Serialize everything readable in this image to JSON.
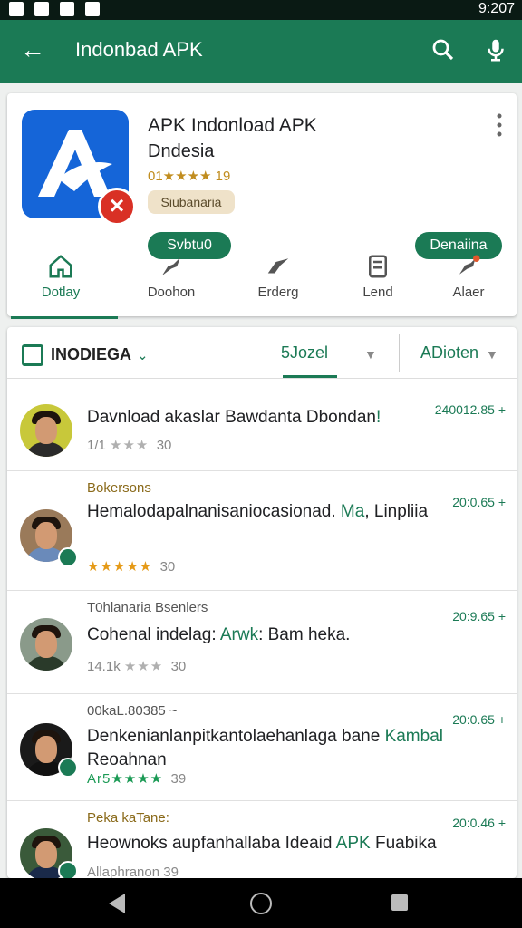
{
  "status_bar": {
    "time": "9:207"
  },
  "app_bar": {
    "title": "Indonbad APK",
    "back_icon": "arrow-back-icon",
    "search_icon": "search-icon",
    "mic_icon": "mic-icon"
  },
  "app_card": {
    "name": "APK Indonload APK",
    "developer": "Dndesia",
    "rating_text": "01★★★★ 19",
    "chip": "Siubanaria",
    "button_left": "Svbtu0",
    "button_right": "Denaiina",
    "tabs": [
      {
        "label": "Dotlay",
        "icon": "home-icon",
        "active": true
      },
      {
        "label": "Doohon",
        "icon": "share-icon",
        "active": false
      },
      {
        "label": "Erderg",
        "icon": "send-icon",
        "active": false
      },
      {
        "label": "Lend",
        "icon": "document-icon",
        "active": false
      },
      {
        "label": "Alaer",
        "icon": "notify-icon",
        "active": false
      }
    ]
  },
  "filter_bar": {
    "label": "INODIEGA",
    "sort": "5Jozel",
    "action": "ADioten"
  },
  "reviews": [
    {
      "subtitle": "",
      "title": "Davnload akaslar Bawdanta Dbondan",
      "title_accent": "!",
      "meta_prefix": "1/1",
      "stars": "★★★",
      "count": "30",
      "date": "240012.85 +"
    },
    {
      "subtitle": "Bokersons",
      "title": "Hemalodapalnanisaniocasionad.",
      "title_accent": "Ma",
      "title_tail": ", Linpliia",
      "meta_prefix": "",
      "stars": "★★★★★",
      "count": "30",
      "date": "20:0.65 +"
    },
    {
      "subtitle": "T0hlanaria Bsenlers",
      "title": "Cohenal indelag: ",
      "title_accent": "Arwk",
      "title_tail": ": Bam heka.",
      "meta_prefix": "14.1k",
      "stars": "★★★",
      "count": "30",
      "date": "20:9.65 +"
    },
    {
      "subtitle": "00kaL.80385 ~",
      "title": "Denkenianlanpitkantolaehanlaga bane ",
      "title_accent": "Kambal",
      "title_tail": " Reoahnan",
      "meta_prefix": "Ar5",
      "stars": "★★★★",
      "count": "39",
      "date": "20:0.65 +"
    },
    {
      "subtitle": "Peka kaTane:",
      "title": "Heownoks aupfanhallaba Ideaid ",
      "title_accent": "APK",
      "title_tail": " Fuabika",
      "meta_prefix": "Allaphranon",
      "stars": "",
      "count": "39",
      "date": "20:0.46 +"
    }
  ],
  "nav": {
    "back_icon": "nav-back-icon",
    "home_icon": "nav-home-icon",
    "recents_icon": "nav-recents-icon"
  }
}
